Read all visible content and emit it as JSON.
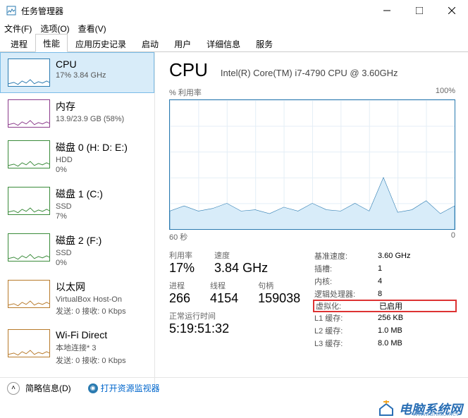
{
  "window": {
    "title": "任务管理器"
  },
  "menu": {
    "file": "文件(F)",
    "options": "选项(O)",
    "view": "查看(V)"
  },
  "tabs": [
    "进程",
    "性能",
    "应用历史记录",
    "启动",
    "用户",
    "详细信息",
    "服务"
  ],
  "active_tab": 1,
  "sidebar": [
    {
      "name": "CPU",
      "sub": "17% 3.84 GHz",
      "color": "#2a7ab0"
    },
    {
      "name": "内存",
      "sub": "13.9/23.9 GB (58%)",
      "color": "#8b3a8b"
    },
    {
      "name": "磁盘 0 (H: D: E:)",
      "sub": "HDD",
      "sub2": "0%",
      "color": "#3a8b3a"
    },
    {
      "name": "磁盘 1 (C:)",
      "sub": "SSD",
      "sub2": "7%",
      "color": "#3a8b3a"
    },
    {
      "name": "磁盘 2 (F:)",
      "sub": "SSD",
      "sub2": "0%",
      "color": "#3a8b3a"
    },
    {
      "name": "以太网",
      "sub": "VirtualBox Host-On",
      "sub2": "发送: 0 接收: 0 Kbps",
      "color": "#b87a2a"
    },
    {
      "name": "Wi-Fi Direct",
      "sub": "本地连接* 3",
      "sub2": "发送: 0 接收: 0 Kbps",
      "color": "#b87a2a"
    }
  ],
  "detail": {
    "title": "CPU",
    "model": "Intel(R) Core(TM) i7-4790 CPU @ 3.60GHz",
    "ylabel": "% 利用率",
    "ymax": "100%",
    "xleft": "60 秒",
    "xright": "0",
    "stats": {
      "util_lbl": "利用率",
      "util": "17%",
      "speed_lbl": "速度",
      "speed": "3.84 GHz",
      "proc_lbl": "进程",
      "proc": "266",
      "thread_lbl": "线程",
      "thread": "4154",
      "handle_lbl": "句柄",
      "handle": "159038",
      "uptime_lbl": "正常运行时间",
      "uptime": "5:19:51:32"
    },
    "specs": [
      {
        "k": "基准速度:",
        "v": "3.60 GHz"
      },
      {
        "k": "插槽:",
        "v": "1"
      },
      {
        "k": "内核:",
        "v": "4"
      },
      {
        "k": "逻辑处理器:",
        "v": "8"
      },
      {
        "k": "虚拟化:",
        "v": "已启用",
        "hl": true
      },
      {
        "k": "L1 缓存:",
        "v": "256 KB"
      },
      {
        "k": "L2 缓存:",
        "v": "1.0 MB"
      },
      {
        "k": "L3 缓存:",
        "v": "8.0 MB"
      }
    ]
  },
  "bottom": {
    "less": "简略信息(D)",
    "monitor": "打开资源监视器"
  },
  "chart_data": {
    "type": "line",
    "title": "% 利用率",
    "xlabel": "秒",
    "ylabel": "%",
    "ylim": [
      0,
      100
    ],
    "xlim": [
      60,
      0
    ],
    "x": [
      60,
      57,
      54,
      51,
      48,
      45,
      42,
      39,
      36,
      33,
      30,
      27,
      24,
      21,
      18,
      15,
      12,
      9,
      6,
      3,
      0
    ],
    "values": [
      14,
      18,
      14,
      16,
      20,
      14,
      15,
      12,
      17,
      14,
      20,
      15,
      14,
      20,
      14,
      40,
      13,
      15,
      22,
      12,
      18
    ]
  },
  "watermark": {
    "brand": "电脑系统网",
    "url": "www.dnxtc.net"
  }
}
